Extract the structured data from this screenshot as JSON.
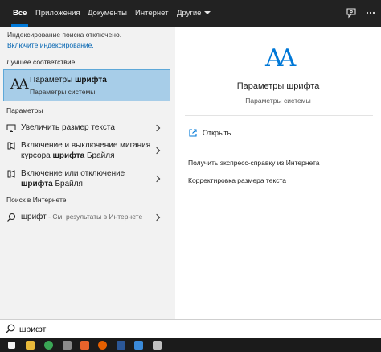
{
  "tabs": [
    {
      "label": "Все",
      "active": true
    },
    {
      "label": "Приложения"
    },
    {
      "label": "Документы"
    },
    {
      "label": "Интернет"
    },
    {
      "label": "Другие"
    }
  ],
  "left": {
    "notice_text": "Индексирование поиска отключено.",
    "notice_link": "Включите индексирование.",
    "best_match_header": "Лучшее соответствие",
    "best_match": {
      "title_plain": "Параметры ",
      "title_bold": "шрифта",
      "subtitle": "Параметры системы"
    },
    "settings_header": "Параметры",
    "settings_items": [
      {
        "line1": "Увеличить размер текста",
        "line2_pre": "",
        "line2_bold": "",
        "line2_post": ""
      },
      {
        "line1": "Включение и выключение мигания",
        "line2_pre": "курсора ",
        "line2_bold": "шрифта",
        "line2_post": " Брайля"
      },
      {
        "line1": "Включение или отключение",
        "line2_pre": "",
        "line2_bold": "шрифта",
        "line2_post": " Брайля"
      }
    ],
    "web_header": "Поиск в Интернете",
    "web_item": {
      "query": "шрифт",
      "suffix": " - См. результаты в Интернете"
    }
  },
  "right": {
    "title": "Параметры шрифта",
    "subtitle": "Параметры системы",
    "open_label": "Открыть",
    "help_header": "Получить экспресс-справку из Интернета",
    "help_item": "Корректировка размера текста"
  },
  "search": {
    "value": "шрифт"
  },
  "colors": {
    "accent": "#0078d7",
    "selection": "#a7cde8",
    "topbar": "#222222"
  }
}
